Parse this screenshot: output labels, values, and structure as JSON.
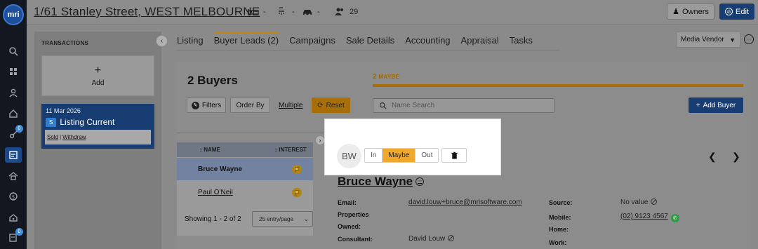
{
  "header": {
    "address": "1/61 Stanley Street, WEST MELBOURNE",
    "beds": "-",
    "baths": "-",
    "cars": "-",
    "contacts_count": "29",
    "owners_label": "Owners",
    "edit_label": "Edit"
  },
  "logo_text": "mri",
  "rail_badges": [
    "0",
    "0"
  ],
  "transactions": {
    "title": "TRANSACTIONS",
    "add_label": "Add",
    "card": {
      "date": "11 Mar 2026",
      "badge": "S",
      "status": "Listing Current",
      "sold_link": "Sold",
      "separator": "|",
      "withdraw_link": "Withdraw"
    }
  },
  "tabs": [
    {
      "label": "Listing"
    },
    {
      "label": "Buyer Leads (2)"
    },
    {
      "label": "Campaigns"
    },
    {
      "label": "Sale Details"
    },
    {
      "label": "Accounting"
    },
    {
      "label": "Appraisal"
    },
    {
      "label": "Tasks"
    }
  ],
  "media_vendor": "Media Vendor",
  "buyers": {
    "title": "2 Buyers",
    "maybe_count": "2",
    "maybe_label": "MAYBE",
    "filters_label": "Filters",
    "order_by_label": "Order By",
    "multiple_label": "Multiple",
    "reset_label": "Reset",
    "search_placeholder": "Name Search",
    "add_buyer_label": "Add Buyer"
  },
  "table": {
    "col_name": "NAME",
    "col_interest": "INTEREST",
    "rows": [
      {
        "name": "Bruce Wayne"
      },
      {
        "name": "Paul O'Neil"
      }
    ],
    "showing": "Showing 1 - 2 of 2",
    "per_page": "25 entry/page"
  },
  "popover": {
    "initials": "BW",
    "options": [
      "In",
      "Maybe",
      "Out"
    ],
    "selected": "Maybe"
  },
  "details": {
    "name": "Bruce Wayne",
    "email_label": "Email:",
    "email": "david.louw+bruce@mrisoftware.com",
    "properties_label": "Properties",
    "owned_label": "Owned:",
    "consultant_label": "Consultant:",
    "consultant": "David Louw",
    "source_label": "Source:",
    "source": "No value",
    "mobile_label": "Mobile:",
    "mobile": "(02) 9123 4567",
    "home_label": "Home:",
    "work_label": "Work:"
  },
  "colors": {
    "accent": "#173d72",
    "maybe": "#f0a92d"
  }
}
